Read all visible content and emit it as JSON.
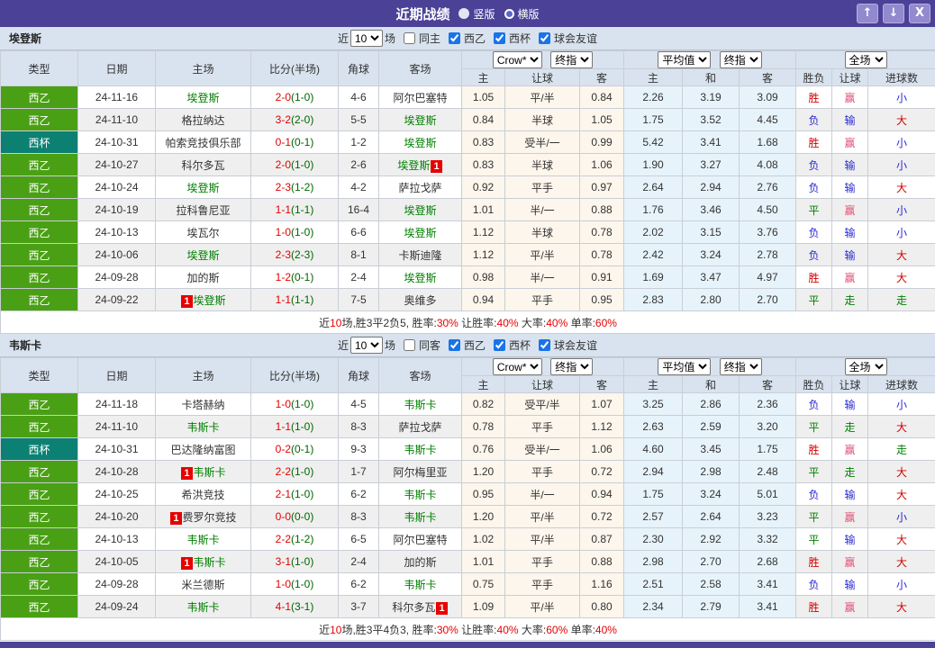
{
  "titlebar": {
    "title": "近期战绩",
    "radio_vertical": "竖版",
    "radio_horizontal": "横版",
    "up_icon": "↑",
    "down_icon": "↓",
    "close_icon": "X"
  },
  "headers": {
    "left": [
      "类型",
      "日期",
      "主场",
      "比分(半场)",
      "角球",
      "客场"
    ],
    "odds_select_company": "Crow*",
    "odds_select_type": "终指",
    "avg_select_company": "平均值",
    "avg_select_type": "终指",
    "result_select": "全场",
    "odds_sub": [
      "主",
      "让球",
      "客"
    ],
    "avg_sub": [
      "主",
      "和",
      "客"
    ],
    "result_sub": [
      "胜负",
      "让球",
      "进球数"
    ]
  },
  "filter_labels": {
    "prefix": "近",
    "count": "10",
    "suffix": "场",
    "leagues": [
      "西乙",
      "西杯",
      "球会友谊"
    ]
  },
  "colors": {
    "titlebar_purple": "#4b4297",
    "league_green": "#4aa014",
    "cup_teal": "#0d8074",
    "team_link_green": "#008000",
    "score_red": "#e60000",
    "halftime_green": "#006600",
    "win_red": "#d40000",
    "draw_green": "#008000",
    "lose_blue": "#2a2ad0",
    "handicap_win_pink": "#e25078",
    "odds_col_bg": "#fcf6ec",
    "avg_col_bg": "#e7f3fa"
  },
  "sections": [
    {
      "team": "埃登斯",
      "same_label": "同主",
      "rows": [
        {
          "type": "西乙",
          "tc": "green",
          "date": "24-11-16",
          "home": {
            "n": "埃登斯",
            "g": true,
            "card": ""
          },
          "ft": "2-0",
          "ht": "(1-0)",
          "corner": "4-6",
          "away": {
            "n": "阿尔巴塞特",
            "g": false,
            "card": ""
          },
          "odds": [
            "1.05",
            "平/半",
            "0.84"
          ],
          "avg": [
            "2.26",
            "3.19",
            "3.09"
          ],
          "res": [
            [
              "胜",
              "red"
            ],
            [
              "赢",
              "pink"
            ],
            [
              "小",
              "blue"
            ]
          ]
        },
        {
          "type": "西乙",
          "tc": "green",
          "date": "24-11-10",
          "home": {
            "n": "格拉纳达",
            "g": false,
            "card": ""
          },
          "ft": "3-2",
          "ht": "(2-0)",
          "corner": "5-5",
          "away": {
            "n": "埃登斯",
            "g": true,
            "card": ""
          },
          "odds": [
            "0.84",
            "半球",
            "1.05"
          ],
          "avg": [
            "1.75",
            "3.52",
            "4.45"
          ],
          "res": [
            [
              "负",
              "blue"
            ],
            [
              "输",
              "blue"
            ],
            [
              "大",
              "red"
            ]
          ]
        },
        {
          "type": "西杯",
          "tc": "teal",
          "date": "24-10-31",
          "home": {
            "n": "帕索竞技俱乐部",
            "g": false,
            "card": ""
          },
          "ft": "0-1",
          "ht": "(0-1)",
          "corner": "1-2",
          "away": {
            "n": "埃登斯",
            "g": true,
            "card": ""
          },
          "odds": [
            "0.83",
            "受半/一",
            "0.99"
          ],
          "avg": [
            "5.42",
            "3.41",
            "1.68"
          ],
          "res": [
            [
              "胜",
              "red"
            ],
            [
              "赢",
              "pink"
            ],
            [
              "小",
              "blue"
            ]
          ]
        },
        {
          "type": "西乙",
          "tc": "green",
          "date": "24-10-27",
          "home": {
            "n": "科尔多瓦",
            "g": false,
            "card": ""
          },
          "ft": "2-0",
          "ht": "(1-0)",
          "corner": "2-6",
          "away": {
            "n": "埃登斯",
            "g": true,
            "card": "right"
          },
          "odds": [
            "0.83",
            "半球",
            "1.06"
          ],
          "avg": [
            "1.90",
            "3.27",
            "4.08"
          ],
          "res": [
            [
              "负",
              "blue"
            ],
            [
              "输",
              "blue"
            ],
            [
              "小",
              "blue"
            ]
          ]
        },
        {
          "type": "西乙",
          "tc": "green",
          "date": "24-10-24",
          "home": {
            "n": "埃登斯",
            "g": true,
            "card": ""
          },
          "ft": "2-3",
          "ht": "(1-2)",
          "corner": "4-2",
          "away": {
            "n": "萨拉戈萨",
            "g": false,
            "card": ""
          },
          "odds": [
            "0.92",
            "平手",
            "0.97"
          ],
          "avg": [
            "2.64",
            "2.94",
            "2.76"
          ],
          "res": [
            [
              "负",
              "blue"
            ],
            [
              "输",
              "blue"
            ],
            [
              "大",
              "red"
            ]
          ]
        },
        {
          "type": "西乙",
          "tc": "green",
          "date": "24-10-19",
          "home": {
            "n": "拉科鲁尼亚",
            "g": false,
            "card": ""
          },
          "ft": "1-1",
          "ht": "(1-1)",
          "corner": "16-4",
          "away": {
            "n": "埃登斯",
            "g": true,
            "card": ""
          },
          "odds": [
            "1.01",
            "半/一",
            "0.88"
          ],
          "avg": [
            "1.76",
            "3.46",
            "4.50"
          ],
          "res": [
            [
              "平",
              "green"
            ],
            [
              "赢",
              "pink"
            ],
            [
              "小",
              "blue"
            ]
          ]
        },
        {
          "type": "西乙",
          "tc": "green",
          "date": "24-10-13",
          "home": {
            "n": "埃瓦尔",
            "g": false,
            "card": ""
          },
          "ft": "1-0",
          "ht": "(1-0)",
          "corner": "6-6",
          "away": {
            "n": "埃登斯",
            "g": true,
            "card": ""
          },
          "odds": [
            "1.12",
            "半球",
            "0.78"
          ],
          "avg": [
            "2.02",
            "3.15",
            "3.76"
          ],
          "res": [
            [
              "负",
              "blue"
            ],
            [
              "输",
              "blue"
            ],
            [
              "小",
              "blue"
            ]
          ]
        },
        {
          "type": "西乙",
          "tc": "green",
          "date": "24-10-06",
          "home": {
            "n": "埃登斯",
            "g": true,
            "card": ""
          },
          "ft": "2-3",
          "ht": "(2-3)",
          "corner": "8-1",
          "away": {
            "n": "卡斯迪隆",
            "g": false,
            "card": ""
          },
          "odds": [
            "1.12",
            "平/半",
            "0.78"
          ],
          "avg": [
            "2.42",
            "3.24",
            "2.78"
          ],
          "res": [
            [
              "负",
              "blue"
            ],
            [
              "输",
              "blue"
            ],
            [
              "大",
              "red"
            ]
          ]
        },
        {
          "type": "西乙",
          "tc": "green",
          "date": "24-09-28",
          "home": {
            "n": "加的斯",
            "g": false,
            "card": ""
          },
          "ft": "1-2",
          "ht": "(0-1)",
          "corner": "2-4",
          "away": {
            "n": "埃登斯",
            "g": true,
            "card": ""
          },
          "odds": [
            "0.98",
            "半/一",
            "0.91"
          ],
          "avg": [
            "1.69",
            "3.47",
            "4.97"
          ],
          "res": [
            [
              "胜",
              "red"
            ],
            [
              "赢",
              "pink"
            ],
            [
              "大",
              "red"
            ]
          ]
        },
        {
          "type": "西乙",
          "tc": "green",
          "date": "24-09-22",
          "home": {
            "n": "埃登斯",
            "g": true,
            "card": "left"
          },
          "ft": "1-1",
          "ht": "(1-1)",
          "corner": "7-5",
          "away": {
            "n": "奥维多",
            "g": false,
            "card": ""
          },
          "odds": [
            "0.94",
            "平手",
            "0.95"
          ],
          "avg": [
            "2.83",
            "2.80",
            "2.70"
          ],
          "res": [
            [
              "平",
              "green"
            ],
            [
              "走",
              "green"
            ],
            [
              "走",
              "green"
            ]
          ]
        }
      ],
      "summary": [
        {
          "t": "近",
          "r": false
        },
        {
          "t": "10",
          "r": true
        },
        {
          "t": "场,胜3平2负5, 胜率:",
          "r": false
        },
        {
          "t": "30%",
          "r": true
        },
        {
          "t": " 让胜率:",
          "r": false
        },
        {
          "t": "40%",
          "r": true
        },
        {
          "t": " 大率:",
          "r": false
        },
        {
          "t": "40%",
          "r": true
        },
        {
          "t": " 单率:",
          "r": false
        },
        {
          "t": "60%",
          "r": true
        }
      ]
    },
    {
      "team": "韦斯卡",
      "same_label": "同客",
      "rows": [
        {
          "type": "西乙",
          "tc": "green",
          "date": "24-11-18",
          "home": {
            "n": "卡塔赫纳",
            "g": false,
            "card": ""
          },
          "ft": "1-0",
          "ht": "(1-0)",
          "corner": "4-5",
          "away": {
            "n": "韦斯卡",
            "g": true,
            "card": ""
          },
          "odds": [
            "0.82",
            "受平/半",
            "1.07"
          ],
          "avg": [
            "3.25",
            "2.86",
            "2.36"
          ],
          "res": [
            [
              "负",
              "blue"
            ],
            [
              "输",
              "blue"
            ],
            [
              "小",
              "blue"
            ]
          ]
        },
        {
          "type": "西乙",
          "tc": "green",
          "date": "24-11-10",
          "home": {
            "n": "韦斯卡",
            "g": true,
            "card": ""
          },
          "ft": "1-1",
          "ht": "(1-0)",
          "corner": "8-3",
          "away": {
            "n": "萨拉戈萨",
            "g": false,
            "card": ""
          },
          "odds": [
            "0.78",
            "平手",
            "1.12"
          ],
          "avg": [
            "2.63",
            "2.59",
            "3.20"
          ],
          "res": [
            [
              "平",
              "green"
            ],
            [
              "走",
              "green"
            ],
            [
              "大",
              "red"
            ]
          ]
        },
        {
          "type": "西杯",
          "tc": "teal",
          "date": "24-10-31",
          "home": {
            "n": "巴达隆纳富图",
            "g": false,
            "card": ""
          },
          "ft": "0-2",
          "ht": "(0-1)",
          "corner": "9-3",
          "away": {
            "n": "韦斯卡",
            "g": true,
            "card": ""
          },
          "odds": [
            "0.76",
            "受半/一",
            "1.06"
          ],
          "avg": [
            "4.60",
            "3.45",
            "1.75"
          ],
          "res": [
            [
              "胜",
              "red"
            ],
            [
              "赢",
              "pink"
            ],
            [
              "走",
              "green"
            ]
          ]
        },
        {
          "type": "西乙",
          "tc": "green",
          "date": "24-10-28",
          "home": {
            "n": "韦斯卡",
            "g": true,
            "card": "left"
          },
          "ft": "2-2",
          "ht": "(1-0)",
          "corner": "1-7",
          "away": {
            "n": "阿尔梅里亚",
            "g": false,
            "card": ""
          },
          "odds": [
            "1.20",
            "平手",
            "0.72"
          ],
          "avg": [
            "2.94",
            "2.98",
            "2.48"
          ],
          "res": [
            [
              "平",
              "green"
            ],
            [
              "走",
              "green"
            ],
            [
              "大",
              "red"
            ]
          ]
        },
        {
          "type": "西乙",
          "tc": "green",
          "date": "24-10-25",
          "home": {
            "n": "希洪竞技",
            "g": false,
            "card": ""
          },
          "ft": "2-1",
          "ht": "(1-0)",
          "corner": "6-2",
          "away": {
            "n": "韦斯卡",
            "g": true,
            "card": ""
          },
          "odds": [
            "0.95",
            "半/一",
            "0.94"
          ],
          "avg": [
            "1.75",
            "3.24",
            "5.01"
          ],
          "res": [
            [
              "负",
              "blue"
            ],
            [
              "输",
              "blue"
            ],
            [
              "大",
              "red"
            ]
          ]
        },
        {
          "type": "西乙",
          "tc": "green",
          "date": "24-10-20",
          "home": {
            "n": "费罗尔竞技",
            "g": false,
            "card": "left"
          },
          "ft": "0-0",
          "ht": "(0-0)",
          "corner": "8-3",
          "away": {
            "n": "韦斯卡",
            "g": true,
            "card": ""
          },
          "odds": [
            "1.20",
            "平/半",
            "0.72"
          ],
          "avg": [
            "2.57",
            "2.64",
            "3.23"
          ],
          "res": [
            [
              "平",
              "green"
            ],
            [
              "赢",
              "pink"
            ],
            [
              "小",
              "blue"
            ]
          ]
        },
        {
          "type": "西乙",
          "tc": "green",
          "date": "24-10-13",
          "home": {
            "n": "韦斯卡",
            "g": true,
            "card": ""
          },
          "ft": "2-2",
          "ht": "(1-2)",
          "corner": "6-5",
          "away": {
            "n": "阿尔巴塞特",
            "g": false,
            "card": ""
          },
          "odds": [
            "1.02",
            "平/半",
            "0.87"
          ],
          "avg": [
            "2.30",
            "2.92",
            "3.32"
          ],
          "res": [
            [
              "平",
              "green"
            ],
            [
              "输",
              "blue"
            ],
            [
              "大",
              "red"
            ]
          ]
        },
        {
          "type": "西乙",
          "tc": "green",
          "date": "24-10-05",
          "home": {
            "n": "韦斯卡",
            "g": true,
            "card": "left"
          },
          "ft": "3-1",
          "ht": "(1-0)",
          "corner": "2-4",
          "away": {
            "n": "加的斯",
            "g": false,
            "card": ""
          },
          "odds": [
            "1.01",
            "平手",
            "0.88"
          ],
          "avg": [
            "2.98",
            "2.70",
            "2.68"
          ],
          "res": [
            [
              "胜",
              "red"
            ],
            [
              "赢",
              "pink"
            ],
            [
              "大",
              "red"
            ]
          ]
        },
        {
          "type": "西乙",
          "tc": "green",
          "date": "24-09-28",
          "home": {
            "n": "米兰德斯",
            "g": false,
            "card": ""
          },
          "ft": "1-0",
          "ht": "(1-0)",
          "corner": "6-2",
          "away": {
            "n": "韦斯卡",
            "g": true,
            "card": ""
          },
          "odds": [
            "0.75",
            "平手",
            "1.16"
          ],
          "avg": [
            "2.51",
            "2.58",
            "3.41"
          ],
          "res": [
            [
              "负",
              "blue"
            ],
            [
              "输",
              "blue"
            ],
            [
              "小",
              "blue"
            ]
          ]
        },
        {
          "type": "西乙",
          "tc": "green",
          "date": "24-09-24",
          "home": {
            "n": "韦斯卡",
            "g": true,
            "card": ""
          },
          "ft": "4-1",
          "ht": "(3-1)",
          "corner": "3-7",
          "away": {
            "n": "科尔多瓦",
            "g": false,
            "card": "right"
          },
          "odds": [
            "1.09",
            "平/半",
            "0.80"
          ],
          "avg": [
            "2.34",
            "2.79",
            "3.41"
          ],
          "res": [
            [
              "胜",
              "red"
            ],
            [
              "赢",
              "pink"
            ],
            [
              "大",
              "red"
            ]
          ]
        }
      ],
      "summary": [
        {
          "t": "近",
          "r": false
        },
        {
          "t": "10",
          "r": true
        },
        {
          "t": "场,胜3平4负3, 胜率:",
          "r": false
        },
        {
          "t": "30%",
          "r": true
        },
        {
          "t": " 让胜率:",
          "r": false
        },
        {
          "t": "40%",
          "r": true
        },
        {
          "t": " 大率:",
          "r": false
        },
        {
          "t": "60%",
          "r": true
        },
        {
          "t": " 单率:",
          "r": false
        },
        {
          "t": "40%",
          "r": true
        }
      ]
    }
  ]
}
